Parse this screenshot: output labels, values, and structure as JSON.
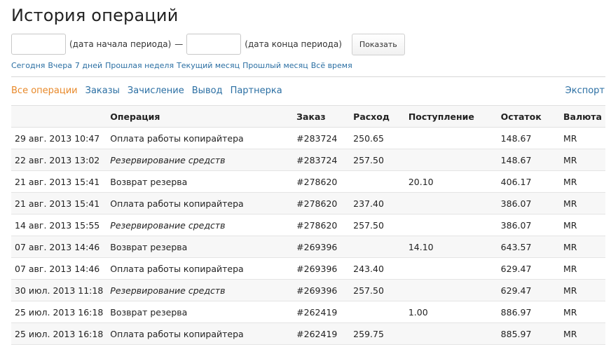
{
  "page": {
    "title": "История операций"
  },
  "filter": {
    "start_value": "",
    "start_label": "(дата начала периода)",
    "dash": "—",
    "end_value": "",
    "end_label": "(дата конца периода)",
    "show_button": "Показать"
  },
  "quick_links": [
    "Сегодня",
    "Вчера",
    "7 дней",
    "Прошлая неделя",
    "Текущий месяц",
    "Прошлый месяц",
    "Всё время"
  ],
  "tabs": [
    {
      "label": "Все операции",
      "active": true
    },
    {
      "label": "Заказы",
      "active": false
    },
    {
      "label": "Зачисление",
      "active": false
    },
    {
      "label": "Вывод",
      "active": false
    },
    {
      "label": "Партнерка",
      "active": false
    }
  ],
  "export_label": "Экспорт",
  "table": {
    "headers": [
      "",
      "Операция",
      "Заказ",
      "Расход",
      "Поступление",
      "Остаток",
      "Валюта"
    ],
    "rows": [
      {
        "date": "29 авг. 2013 10:47",
        "operation": "Оплата работы копирайтера",
        "italic": false,
        "order": "#283724",
        "expense": "250.65",
        "income": "",
        "balance": "148.67",
        "currency": "MR"
      },
      {
        "date": "22 авг. 2013 13:02",
        "operation": "Резервирование средств",
        "italic": true,
        "order": "#283724",
        "expense": "257.50",
        "income": "",
        "balance": "148.67",
        "currency": "MR"
      },
      {
        "date": "21 авг. 2013 15:41",
        "operation": "Возврат резерва",
        "italic": false,
        "order": "#278620",
        "expense": "",
        "income": "20.10",
        "balance": "406.17",
        "currency": "MR"
      },
      {
        "date": "21 авг. 2013 15:41",
        "operation": "Оплата работы копирайтера",
        "italic": false,
        "order": "#278620",
        "expense": "237.40",
        "income": "",
        "balance": "386.07",
        "currency": "MR"
      },
      {
        "date": "14 авг. 2013 15:55",
        "operation": "Резервирование средств",
        "italic": true,
        "order": "#278620",
        "expense": "257.50",
        "income": "",
        "balance": "386.07",
        "currency": "MR"
      },
      {
        "date": "07 авг. 2013 14:46",
        "operation": "Возврат резерва",
        "italic": false,
        "order": "#269396",
        "expense": "",
        "income": "14.10",
        "balance": "643.57",
        "currency": "MR"
      },
      {
        "date": "07 авг. 2013 14:46",
        "operation": "Оплата работы копирайтера",
        "italic": false,
        "order": "#269396",
        "expense": "243.40",
        "income": "",
        "balance": "629.47",
        "currency": "MR"
      },
      {
        "date": "30 июл. 2013 11:18",
        "operation": "Резервирование средств",
        "italic": true,
        "order": "#269396",
        "expense": "257.50",
        "income": "",
        "balance": "629.47",
        "currency": "MR"
      },
      {
        "date": "25 июл. 2013 16:18",
        "operation": "Возврат резерва",
        "italic": false,
        "order": "#262419",
        "expense": "",
        "income": "1.00",
        "balance": "886.97",
        "currency": "MR"
      },
      {
        "date": "25 июл. 2013 16:18",
        "operation": "Оплата работы копирайтера",
        "italic": false,
        "order": "#262419",
        "expense": "259.75",
        "income": "",
        "balance": "885.97",
        "currency": "MR"
      }
    ]
  },
  "colors": {
    "link": "#2b6fa3",
    "active_tab": "#e8892a",
    "row_alt": "#f7f7f7"
  }
}
